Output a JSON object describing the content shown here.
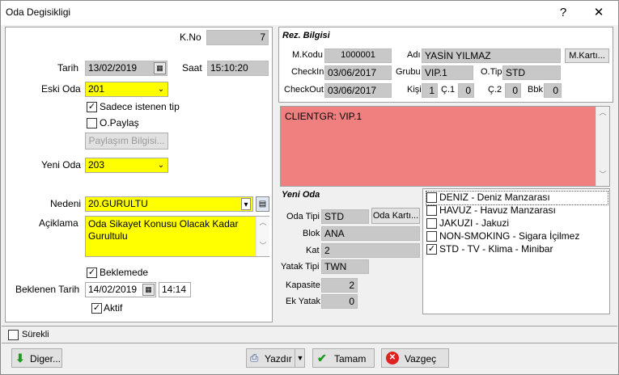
{
  "window": {
    "title": "Oda Degisikligi",
    "help_label": "?",
    "close_label": "✕"
  },
  "left": {
    "kno_label": "K.No",
    "kno_value": "7",
    "tarih_label": "Tarih",
    "tarih_value": "13/02/2019",
    "saat_label": "Saat",
    "saat_value": "15:10:20",
    "eski_oda_label": "Eski Oda",
    "eski_oda_value": "201",
    "sadece_label": "Sadece istenen tip",
    "sadece_checked": true,
    "opaylas_label": "O.Paylaş",
    "opaylas_checked": false,
    "paylasim_button": "Paylaşım Bilgisi...",
    "yeni_oda_label": "Yeni Oda",
    "yeni_oda_value": "203",
    "nedeni_label": "Nedeni",
    "nedeni_value": "20.GURULTU",
    "aciklama_label": "Açiklama",
    "aciklama_value": "Oda Sikayet Konusu Olacak Kadar Gurultulu",
    "beklemede_label": "Beklemede",
    "beklemede_checked": true,
    "beklenen_label": "Beklenen Tarih",
    "beklenen_date": "14/02/2019",
    "beklenen_time": "14:14",
    "aktif_label": "Aktif",
    "aktif_checked": true
  },
  "rez": {
    "title": "Rez. Bilgisi",
    "mkodu_label": "M.Kodu",
    "mkodu_value": "1000001",
    "adi_label": "Adı",
    "adi_value": "YASİN YILMAZ",
    "mkarti_button": "M.Kartı...",
    "checkin_label": "CheckIn",
    "checkin_value": "03/06/2017",
    "grubu_label": "Grubu",
    "grubu_value": "VIP.1",
    "otipi_label": "O.Tipi",
    "otipi_value": "STD",
    "checkout_label": "CheckOut",
    "checkout_value": "03/06/2017",
    "kisi_label": "Kişi",
    "kisi_value": "1",
    "c1_label": "Ç.1",
    "c1_value": "0",
    "c2_label": "Ç.2",
    "c2_value": "0",
    "bbk_label": "Bbk",
    "bbk_value": "0",
    "note_text": "CLIENTGR: VIP.1"
  },
  "yeni_oda": {
    "title": "Yeni Oda",
    "oda_tipi_label": "Oda Tipi",
    "oda_tipi_value": "STD",
    "oda_karti_button": "Oda Kartı...",
    "blok_label": "Blok",
    "blok_value": "ANA",
    "kat_label": "Kat",
    "kat_value": "2",
    "yatak_tipi_label": "Yatak Tipi",
    "yatak_tipi_value": "TWN",
    "kapasite_label": "Kapasite",
    "kapasite_value": "2",
    "ek_yatak_label": "Ek Yatak",
    "ek_yatak_value": "0"
  },
  "features": [
    {
      "label": "DENIZ - Deniz Manzarası",
      "checked": false
    },
    {
      "label": "HAVUZ - Havuz Manzarası",
      "checked": false
    },
    {
      "label": "JAKUZI - Jakuzi",
      "checked": false
    },
    {
      "label": "NON-SMOKING - Sigara İçilmez",
      "checked": false
    },
    {
      "label": "STD - TV - Klima - Minibar",
      "checked": true
    }
  ],
  "status": {
    "surekli_label": "Sürekli",
    "surekli_checked": false
  },
  "footer": {
    "diger_button": "Diger...",
    "yazdir_button": "Yazdır",
    "tamam_button": "Tamam",
    "vazgec_button": "Vazgeç"
  },
  "colors": {
    "highlight": "#ffff00",
    "note": "#f08080",
    "readonly": "#c8c8c8"
  }
}
